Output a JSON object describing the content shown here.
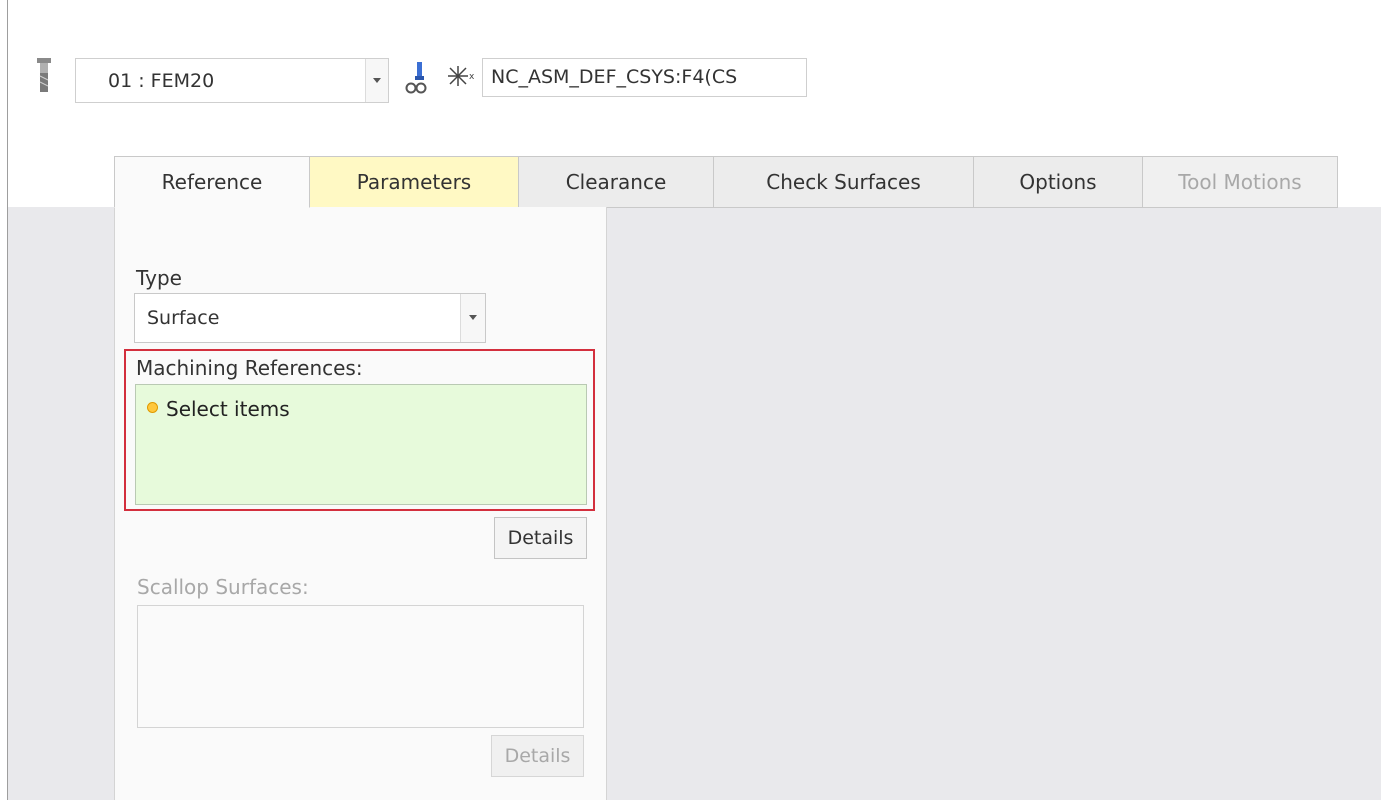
{
  "toolbar": {
    "tool_value": "01 : FEM20",
    "csys_value": "NC_ASM_DEF_CSYS:F4(CS"
  },
  "tabs": [
    {
      "label": "Reference",
      "state": "active"
    },
    {
      "label": "Parameters",
      "state": "highlighted"
    },
    {
      "label": "Clearance",
      "state": "normal"
    },
    {
      "label": "Check Surfaces",
      "state": "normal"
    },
    {
      "label": "Options",
      "state": "normal"
    },
    {
      "label": "Tool Motions",
      "state": "disabled"
    }
  ],
  "reference_panel": {
    "type_label": "Type",
    "type_value": "Surface",
    "machining_refs_label": "Machining References:",
    "machining_refs_prompt": "Select items",
    "details_label": "Details",
    "scallop_label": "Scallop Surfaces:",
    "scallop_details_label": "Details"
  },
  "colors": {
    "accent_highlight_border": "#d32f3d",
    "collector_active_bg": "#e7fadb",
    "parameters_tab_bg": "#fff9c4",
    "prompt_dot": "#ffc83d"
  },
  "icons": [
    "cutting-tool-icon",
    "fixture-icon",
    "coordinate-system-icon",
    "dropdown-arrow-icon",
    "prompt-dot-icon"
  ]
}
